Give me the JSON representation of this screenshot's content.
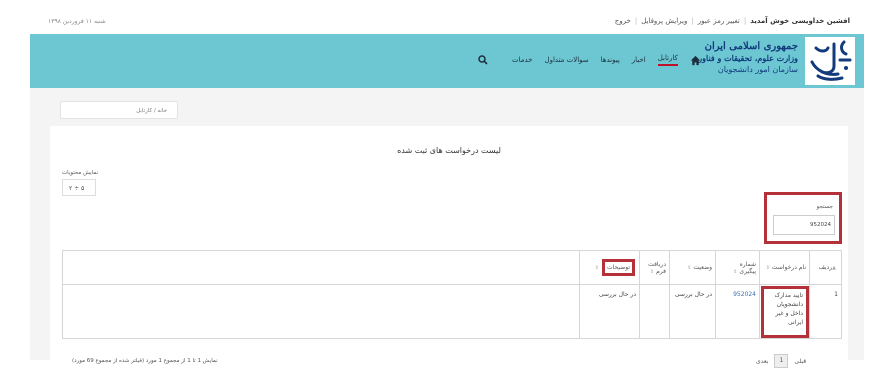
{
  "topbar": {
    "date": "شنبه ۱۱ فروردین ۱۳۹۸",
    "welcome": "افشین خداویسی خوش آمدید",
    "change_password": "تغییر رمز عبور",
    "edit_profile": "ویرایش پروفایل",
    "logout": "خروج"
  },
  "brand": {
    "line1": "جمهوری اسلامی ایران",
    "line2": "وزارت علوم، تحقیقات و فناوری",
    "line3": "سازمان امور دانشجویان"
  },
  "nav": {
    "items": [
      "کارتابل",
      "اخبار",
      "پیوندها",
      "سوالات متداول",
      "خدمات"
    ]
  },
  "breadcrumb": "خانه / کارتابل",
  "panel": {
    "title": "لیست درخواست های ثبت شده",
    "show_label": "نمایش محتویات",
    "show_value": "۲ ÷ ۵",
    "search_label": "جستجو",
    "search_value": "952024"
  },
  "table": {
    "headers": [
      "ردیف",
      "نام درخواست",
      "شماره پیگیری",
      "وضعیت",
      "دریافت فرم",
      "توضیحات"
    ],
    "rows": [
      {
        "index": "1",
        "name": "تایید مدارک دانشجویان داخل و غیر ایرانی",
        "tracking": "952024",
        "status": "در حال بررسی",
        "form": "",
        "notes": "در حال بررسی"
      }
    ]
  },
  "footer": {
    "info": "نمایش 1 تا 1 از مجموع 1 مورد (فیلتر شده از مجموع 69 مورد)",
    "prev": "قبلی",
    "page": "1",
    "next": "بعدی"
  },
  "colors": {
    "header_bg": "#6cc7d2",
    "highlight": "#b5313a",
    "brand_text": "#123a7c"
  }
}
